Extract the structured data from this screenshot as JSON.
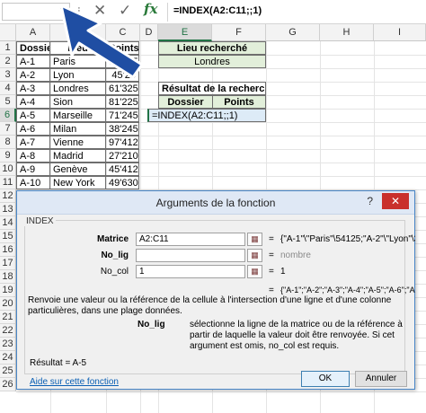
{
  "formula_bar": {
    "namebox": "",
    "fx": "fx",
    "formula": "=INDEX(A2:C11;;1)"
  },
  "columns": [
    "A",
    "B",
    "C",
    "D",
    "E",
    "F",
    "G",
    "H",
    "I"
  ],
  "active_column": "E",
  "rows": [
    "1",
    "2",
    "3",
    "4",
    "5",
    "6",
    "7",
    "8",
    "9",
    "10",
    "11",
    "12",
    "13",
    "14",
    "15",
    "16",
    "17",
    "18",
    "19",
    "20",
    "21",
    "22",
    "23",
    "24",
    "25",
    "26"
  ],
  "active_row": "6",
  "table": {
    "headers": [
      "Dossier",
      "Lieu",
      "Points"
    ],
    "rows": [
      [
        "A-1",
        "Paris",
        "54'125"
      ],
      [
        "A-2",
        "Lyon",
        "45'25"
      ],
      [
        "A-3",
        "Londres",
        "61'325"
      ],
      [
        "A-4",
        "Sion",
        "81'225"
      ],
      [
        "A-5",
        "Marseille",
        "71'245"
      ],
      [
        "A-6",
        "Milan",
        "38'245"
      ],
      [
        "A-7",
        "Vienne",
        "97'412"
      ],
      [
        "A-8",
        "Madrid",
        "27'210"
      ],
      [
        "A-9",
        "Genève",
        "45'412"
      ],
      [
        "A-10",
        "New York",
        "49'630"
      ]
    ]
  },
  "lookup": {
    "title": "Lieu recherché",
    "value": "Londres"
  },
  "result": {
    "title": "Résultat de la recherche",
    "col1": "Dossier",
    "col2": "Points",
    "formula": "=INDEX(A2:C11;;1)"
  },
  "dialog": {
    "title": "Arguments de la fonction",
    "help": "?",
    "close": "✕",
    "function_name": "INDEX",
    "args": [
      {
        "label": "Matrice",
        "value": "A2:C11",
        "result": "{\"A-1\"\\\"Paris\"\\54125;\"A-2\"\\\"Lyon\"\\3547",
        "bold": true,
        "grey": false
      },
      {
        "label": "No_lig",
        "value": "",
        "result": "nombre",
        "bold": true,
        "grey": true
      },
      {
        "label": "No_col",
        "value": "1",
        "result": "1",
        "bold": false,
        "grey": false
      }
    ],
    "formula_result": "{\"A-1\";\"A-2\";\"A-3\";\"A-4\";\"A-5\";\"A-6\";\"A-7",
    "description": "Renvoie une valeur ou la référence de la cellule à l'intersection d'une ligne et d'une colonne particulières, dans une plage données.",
    "arg_name": "No_lig",
    "arg_description": "sélectionne la ligne de la matrice ou de la référence à partir de laquelle la valeur doit être renvoyée. Si cet argument est omis, no_col est requis.",
    "result_text": "Résultat =  A-5",
    "help_link": "Aide sur cette fonction",
    "ok": "OK",
    "cancel": "Annuler"
  },
  "colors": {
    "header_green": "#e2efda",
    "selection_blue": "#ddebf7",
    "excel_green": "#217346",
    "arrow_blue": "#1f4ea3"
  }
}
